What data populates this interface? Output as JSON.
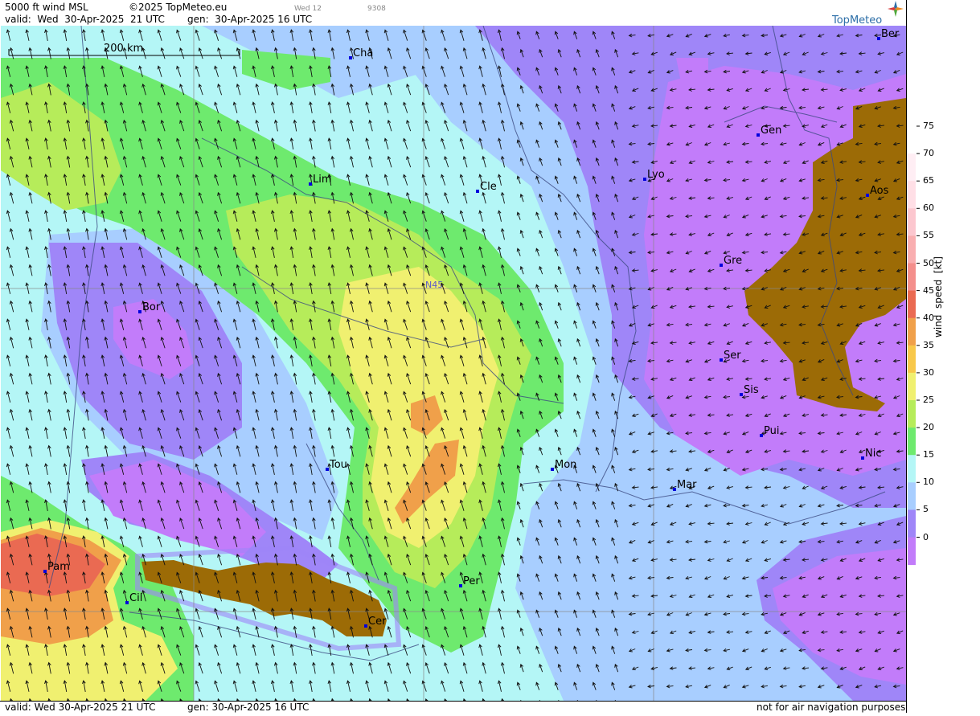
{
  "header": {
    "product": "5000 ft wind MSL",
    "copyright": "©2025 TopMeteo.eu",
    "timecode": "Wed 12",
    "code": "9308",
    "valid": "valid:  Wed  30-Apr-2025  21 UTC",
    "generated": "gen:  30-Apr-2025 16 UTC"
  },
  "logo": {
    "text": "TopMeteo",
    "icon": "compass-star-icon"
  },
  "map": {
    "scale_label": "200 km",
    "grid_label": "N45",
    "colors": {
      "c0": "#c27cfa",
      "c5": "#9f86f8",
      "c10": "#8fa3f4",
      "c15": "#a8ceff",
      "c20": "#b4f6f6",
      "c25": "#6eea6e",
      "c30": "#f0f070",
      "c40": "#f0a04a",
      "c45": "#ea6a52",
      "terrain": "#9c6b06",
      "city": "#0000dd",
      "border": "#3c4a82"
    },
    "cities": [
      {
        "name": "Cha"
      },
      {
        "name": "Ber"
      },
      {
        "name": "Gen"
      },
      {
        "name": "Lim"
      },
      {
        "name": "Cle"
      },
      {
        "name": "Lyo"
      },
      {
        "name": "Aos"
      },
      {
        "name": "Gre"
      },
      {
        "name": "Bor"
      },
      {
        "name": "Ser"
      },
      {
        "name": "Sis"
      },
      {
        "name": "Pui"
      },
      {
        "name": "Tou"
      },
      {
        "name": "Mon"
      },
      {
        "name": "Nic"
      },
      {
        "name": "Mar"
      },
      {
        "name": "Pam"
      },
      {
        "name": "Cil"
      },
      {
        "name": "Cer"
      },
      {
        "name": "Per"
      }
    ]
  },
  "legend": {
    "title": "wind  speed  [kt]",
    "ticks": [
      "75",
      "70",
      "65",
      "60",
      "55",
      "50",
      "45",
      "40",
      "35",
      "30",
      "25",
      "20",
      "15",
      "10",
      "5",
      "0"
    ],
    "swatches": [
      "#ffffff",
      "#ffeef4",
      "#ffdfe6",
      "#fcc7cf",
      "#f9aeb0",
      "#f48f8c",
      "#ea6a52",
      "#f0a04a",
      "#f8c84a",
      "#f0f070",
      "#b6ec5a",
      "#6eea6e",
      "#b4f6f6",
      "#a8ceff",
      "#9f86f8",
      "#c27cfa"
    ]
  },
  "footer": {
    "valid": "valid:  Wed  30-Apr-2025  21 UTC",
    "generated": "gen:  30-Apr-2025 16 UTC",
    "disclaimer": "not for air navigation purposes"
  }
}
